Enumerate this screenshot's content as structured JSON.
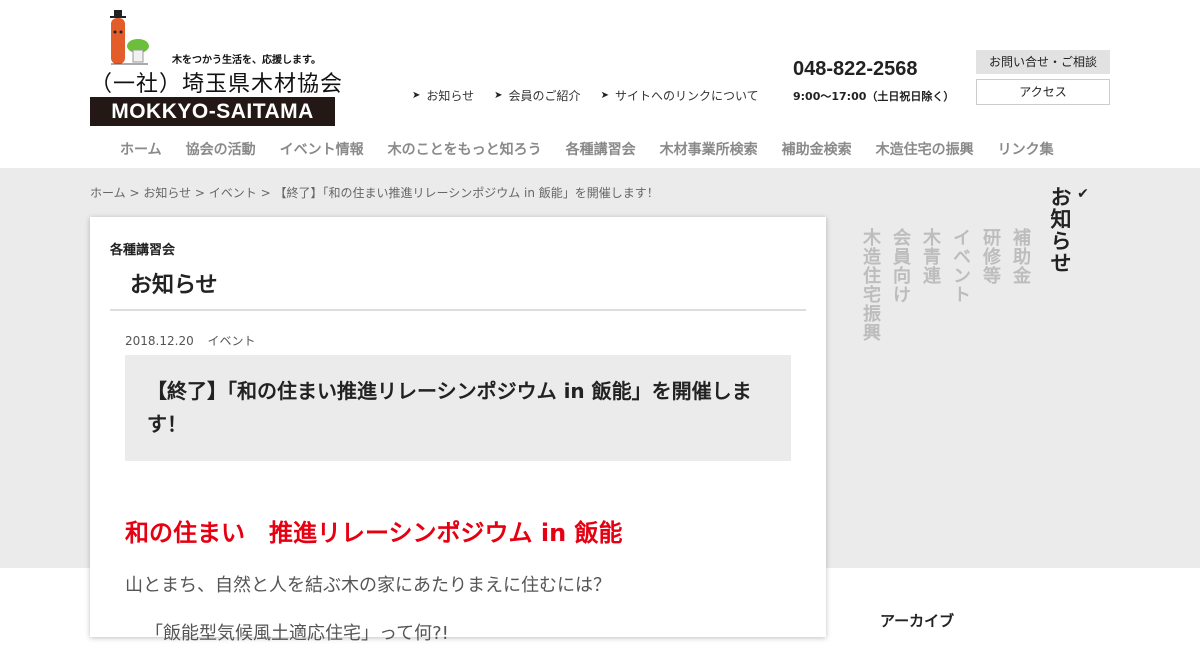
{
  "header": {
    "tagline": "木をつかう生活を、応援します。",
    "org_name": "（一社）埼玉県木材協会",
    "logo_text": "MOKKYO-SAITAMA",
    "subnav": [
      {
        "label": "お知らせ"
      },
      {
        "label": "会員のご紹介"
      },
      {
        "label": "サイトへのリンクについて"
      }
    ],
    "phone": "048-822-2568",
    "hours": "9:00〜17:00（土日祝日除く）",
    "contact_label": "お問い合せ・ご相談",
    "access_label": "アクセス"
  },
  "mainnav": [
    {
      "label": "ホーム"
    },
    {
      "label": "協会の活動"
    },
    {
      "label": "イベント情報"
    },
    {
      "label": "木のことをもっと知ろう"
    },
    {
      "label": "各種講習会"
    },
    {
      "label": "木材事業所検索"
    },
    {
      "label": "補助金検索"
    },
    {
      "label": "木造住宅の振興"
    },
    {
      "label": "リンク集"
    }
  ],
  "breadcrumb": "ホーム > お知らせ > イベント > 【終了】「和の住まい推進リレーシンポジウム in 飯能」を開催します！",
  "card": {
    "category": "各種講習会",
    "title": "お知らせ"
  },
  "post": {
    "date": "2018.12.20",
    "tag": "イベント",
    "title": "【終了】「和の住まい推進リレーシンポジウム in 飯能」を開催します！",
    "heading": "和の住まい　推進リレーシンポジウム in 飯能",
    "text1": "山とまち、自然と人を結ぶ木の家にあたりまえに住むには？",
    "text2": "「飯能型気候風土適応住宅」って何?!"
  },
  "tabs": [
    {
      "label": "お知らせ",
      "active": true
    },
    {
      "label": "補助金"
    },
    {
      "label": "研修等"
    },
    {
      "label": "イベント"
    },
    {
      "label": "木青連"
    },
    {
      "label": "会員向け"
    },
    {
      "label": "木造住宅振興"
    }
  ],
  "sidebar": {
    "archive_title": "アーカイブ"
  },
  "colors": {
    "accent_red": "#e60012",
    "band_grey": "#ebebeb",
    "logo_band": "#231815"
  }
}
